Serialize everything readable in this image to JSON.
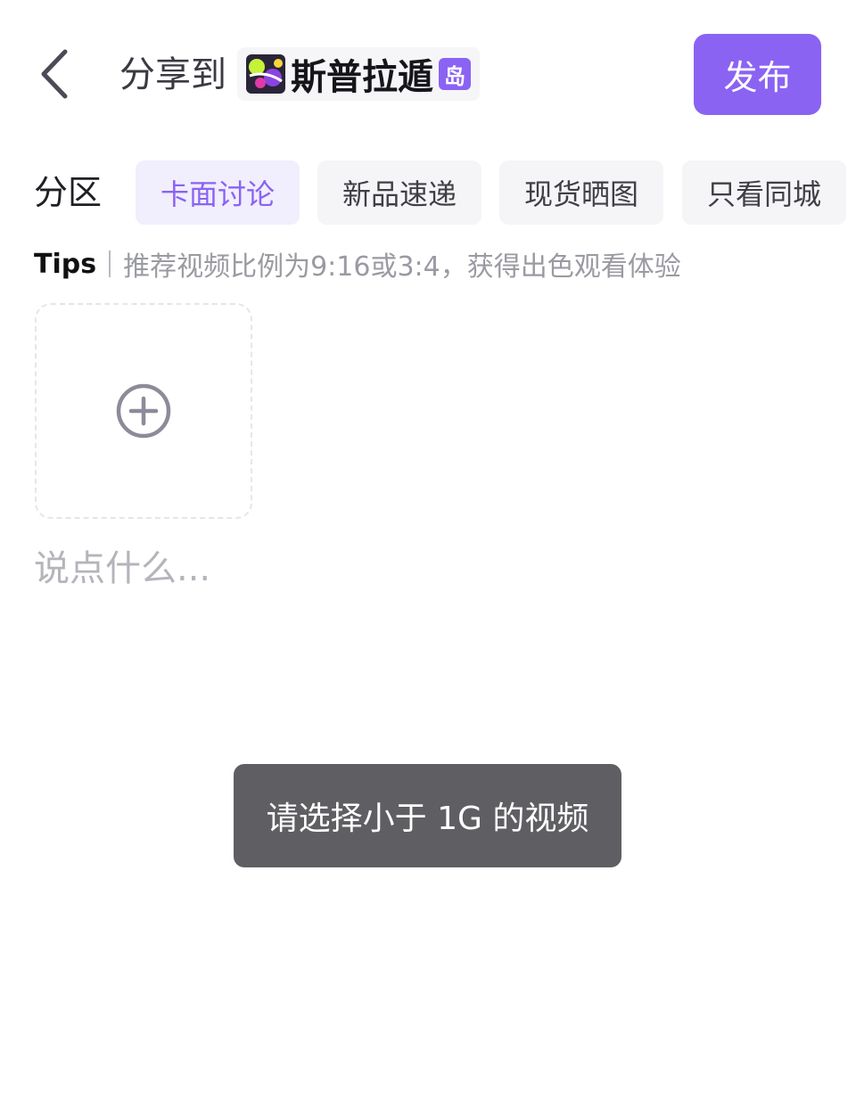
{
  "header": {
    "share_label": "分享到",
    "community_name": "斯普拉遁",
    "island_badge": "岛",
    "publish_label": "发布"
  },
  "section": {
    "label": "分区",
    "tabs": [
      {
        "label": "卡面讨论",
        "active": true
      },
      {
        "label": "新品速递",
        "active": false
      },
      {
        "label": "现货晒图",
        "active": false
      },
      {
        "label": "只看同城",
        "active": false
      }
    ]
  },
  "tips": {
    "label": "Tips",
    "text": "推荐视频比例为9:16或3:4，获得出色观看体验"
  },
  "editor": {
    "placeholder": "说点什么..."
  },
  "toast": {
    "message": "请选择小于 1G 的视频"
  },
  "colors": {
    "accent": "#8a63f3",
    "toast_bg": "#5f5f63"
  }
}
